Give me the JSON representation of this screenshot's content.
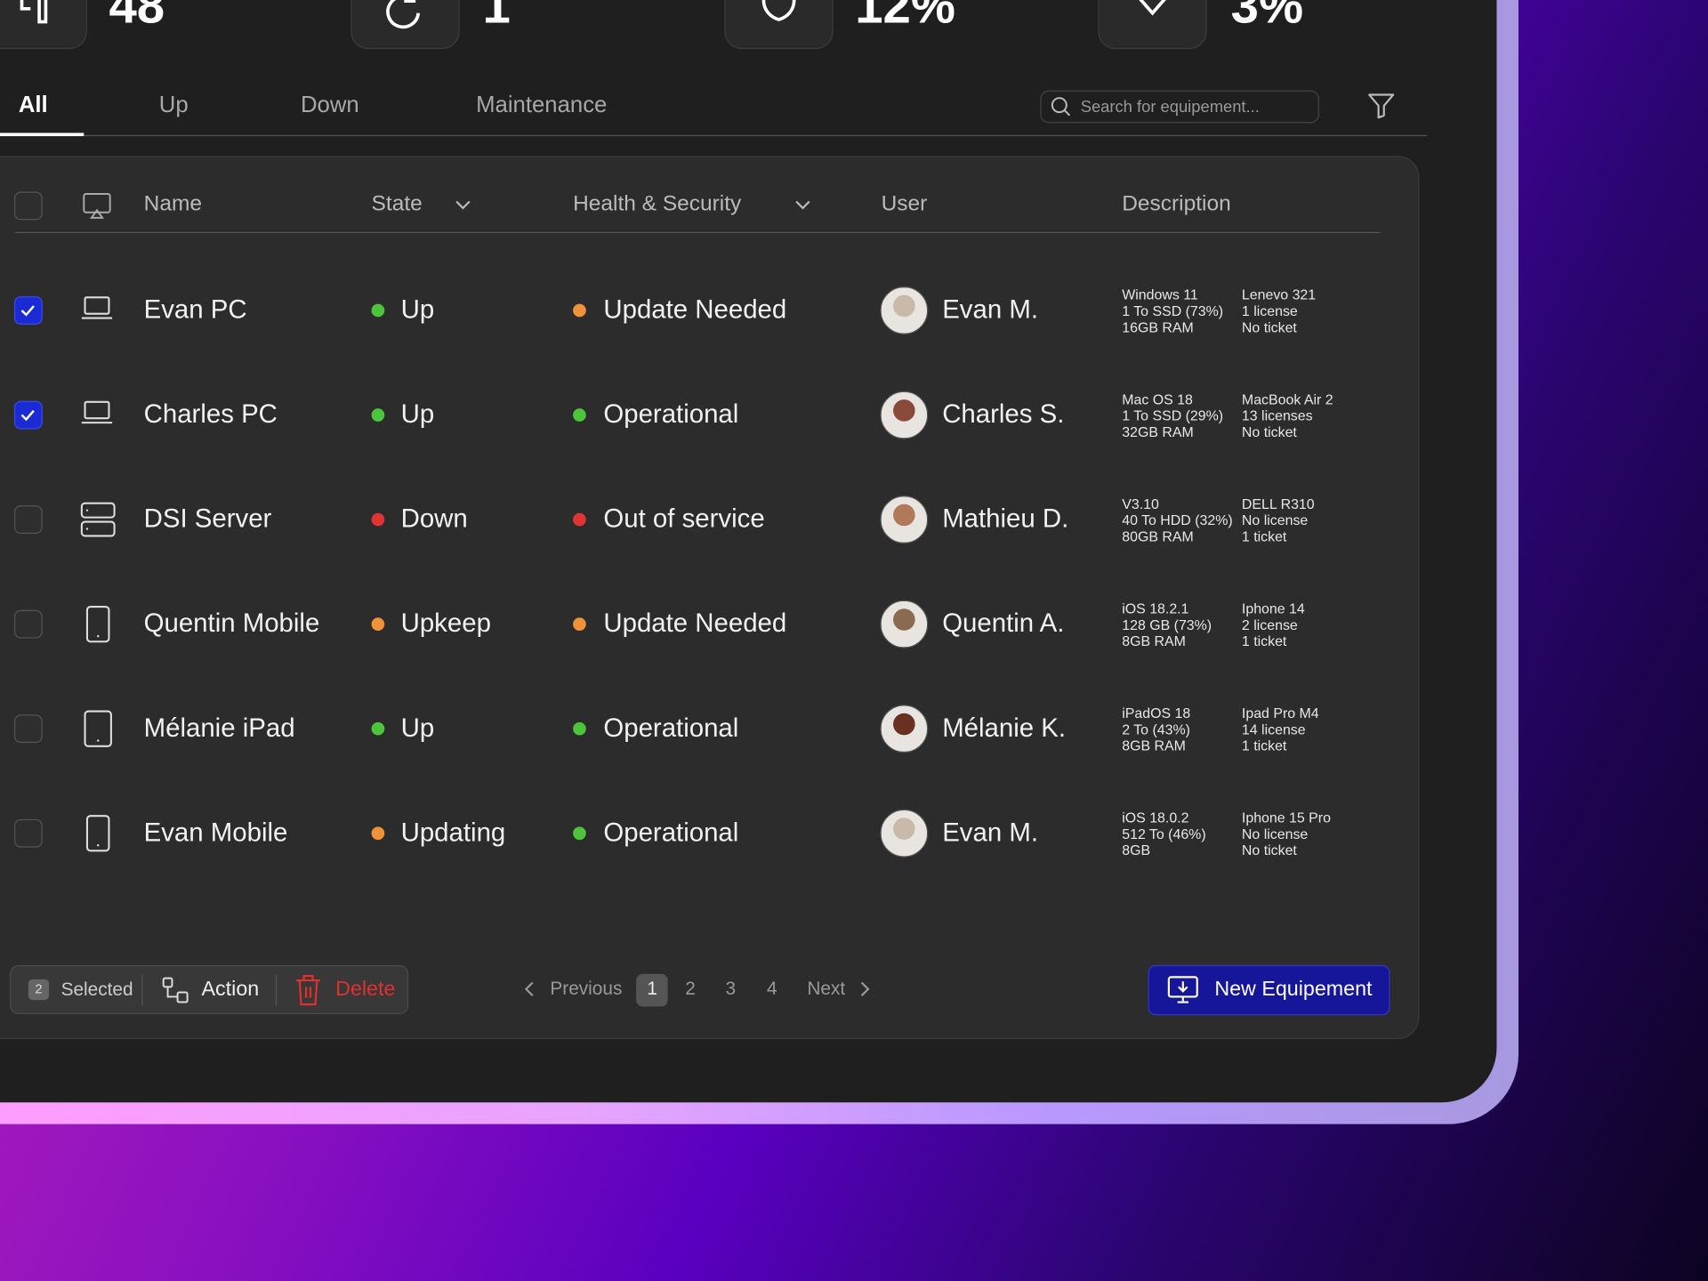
{
  "stats": [
    {
      "value": "48",
      "icon": "devices-icon"
    },
    {
      "value": "1",
      "icon": "refresh-icon"
    },
    {
      "value": "12%",
      "icon": "shield-icon"
    },
    {
      "value": "3%",
      "icon": "diamond-icon"
    }
  ],
  "tabs": [
    {
      "label": "All",
      "active": true
    },
    {
      "label": "Up"
    },
    {
      "label": "Down"
    },
    {
      "label": "Maintenance"
    }
  ],
  "search": {
    "placeholder": "Search for equipement..."
  },
  "table": {
    "headers": {
      "name": "Name",
      "state": "State",
      "health": "Health & Security",
      "user": "User",
      "description": "Description"
    },
    "rows": [
      {
        "checked": true,
        "device": "laptop",
        "name": "Evan PC",
        "state": "Up",
        "state_color": "#4cc53c",
        "health": "Update Needed",
        "health_color": "#f0923a",
        "user": "Evan M.",
        "desc1": "Windows 11\n1 To SSD (73%)\n16GB RAM",
        "desc2": "Lenevo 321\n1 license\nNo ticket"
      },
      {
        "checked": true,
        "device": "laptop",
        "name": "Charles PC",
        "state": "Up",
        "state_color": "#4cc53c",
        "health": "Operational",
        "health_color": "#4cc53c",
        "user": "Charles S.",
        "desc1": "Mac OS 18\n1 To SSD (29%)\n32GB RAM",
        "desc2": "MacBook Air 2\n13 licenses\nNo ticket"
      },
      {
        "checked": false,
        "device": "server",
        "name": "DSI Server",
        "state": "Down",
        "state_color": "#e03434",
        "health": "Out of service",
        "health_color": "#e03434",
        "user": "Mathieu D.",
        "desc1": "V3.10\n40 To HDD (32%)\n80GB RAM",
        "desc2": "DELL R310\nNo license\n1 ticket"
      },
      {
        "checked": false,
        "device": "mobile",
        "name": "Quentin Mobile",
        "state": "Upkeep",
        "state_color": "#f0923a",
        "health": "Update Needed",
        "health_color": "#f0923a",
        "user": "Quentin A.",
        "desc1": "iOS 18.2.1\n128 GB (73%)\n8GB RAM",
        "desc2": "Iphone 14\n2 license\n1 ticket"
      },
      {
        "checked": false,
        "device": "tablet",
        "name": "Mélanie iPad",
        "state": "Up",
        "state_color": "#4cc53c",
        "health": "Operational",
        "health_color": "#4cc53c",
        "user": "Mélanie K.",
        "desc1": "iPadOS 18\n2 To (43%)\n8GB RAM",
        "desc2": "Ipad Pro M4\n14 license\n1 ticket"
      },
      {
        "checked": false,
        "device": "mobile",
        "name": "Evan Mobile",
        "state": "Updating",
        "state_color": "#f0923a",
        "health": "Operational",
        "health_color": "#4cc53c",
        "user": "Evan M.",
        "desc1": "iOS 18.0.2\n512 To (46%)\n8GB",
        "desc2": "Iphone 15 Pro\nNo license\nNo ticket"
      }
    ]
  },
  "footer": {
    "selected_count": "2",
    "selected_label": "Selected",
    "action_label": "Action",
    "delete_label": "Delete",
    "previous": "Previous",
    "pages": [
      "1",
      "2",
      "3",
      "4"
    ],
    "current_page": "1",
    "next": "Next",
    "new_button": "New Equipement"
  },
  "colors": {
    "accent": "#16169a",
    "checkbox": "#1a2bd6",
    "danger": "#e03030"
  }
}
